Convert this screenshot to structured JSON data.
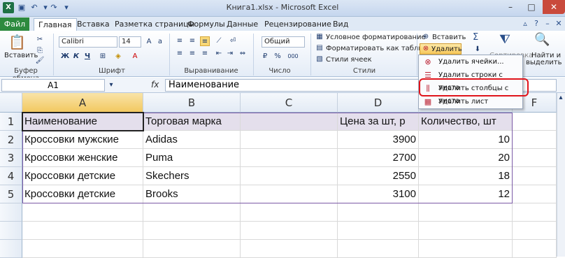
{
  "window": {
    "title": "Книга1.xlsx - Microsoft Excel",
    "app_icon": "X"
  },
  "tabs": [
    {
      "label": "Файл"
    },
    {
      "label": "Главная"
    },
    {
      "label": "Вставка"
    },
    {
      "label": "Разметка страницы"
    },
    {
      "label": "Формулы"
    },
    {
      "label": "Данные"
    },
    {
      "label": "Рецензирование"
    },
    {
      "label": "Вид"
    }
  ],
  "ribbon": {
    "clipboard": {
      "label": "Буфер обмена",
      "paste_label": "Вставить"
    },
    "font": {
      "label": "Шрифт",
      "name": "Calibri",
      "size": "14",
      "bold": "Ж",
      "italic": "К",
      "underline": "Ч"
    },
    "alignment": {
      "label": "Выравнивание"
    },
    "number": {
      "label": "Число",
      "format": "Общий",
      "percent": "%",
      "thousands": "000"
    },
    "styles": {
      "label": "Стили",
      "conditional": "Условное форматирование",
      "as_table": "Форматировать как таблицу",
      "cell_styles": "Стили ячеек"
    },
    "cells": {
      "insert": "Вставить",
      "delete": "Удалить"
    },
    "editing": {
      "sort": "Сортировка",
      "find": "Найти и",
      "select": "выделить"
    }
  },
  "delete_menu": {
    "items": [
      {
        "label": "Удалить ячейки..."
      },
      {
        "label": "Удалить строки с листа"
      },
      {
        "label": "Удалить столбцы с листа"
      },
      {
        "label": "Удалить лист"
      }
    ]
  },
  "formula_bar": {
    "name_box": "A1",
    "fx": "fx",
    "value": "Наименование"
  },
  "sheet": {
    "columns": [
      "A",
      "B",
      "C",
      "D",
      "E",
      "F"
    ],
    "rows": [
      "1",
      "2",
      "3",
      "4",
      "5"
    ],
    "header": [
      "Наименование",
      "Торговая марка",
      "",
      "Цена за шт, р",
      "Количество, шт"
    ],
    "data": [
      [
        "Кроссовки мужские",
        "Adidas",
        "",
        "3900",
        "10"
      ],
      [
        "Кроссовки женские",
        "Puma",
        "",
        "2700",
        "20"
      ],
      [
        "Кроссовки детские",
        "Skechers",
        "",
        "2550",
        "18"
      ],
      [
        "Кроссовки детские",
        "Brooks",
        "",
        "3100",
        "12"
      ]
    ]
  },
  "colors": {
    "file_tab": "#2d8a3e",
    "header_row_fill": "#e4dfec",
    "table_border": "#7b5aa6",
    "highlight": "#e0141b"
  }
}
